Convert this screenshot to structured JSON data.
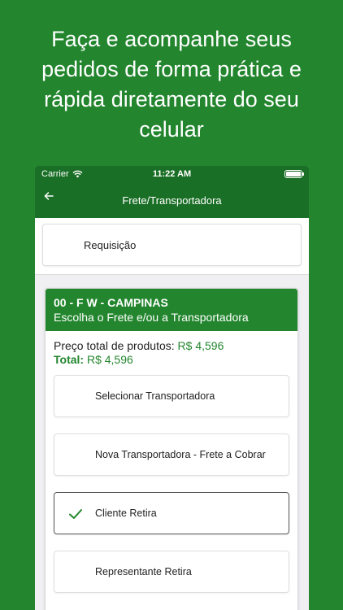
{
  "promo": {
    "headline": "Faça e acompanhe seus pedidos de forma prática e rápida diretamente do seu celular"
  },
  "status_bar": {
    "carrier": "Carrier",
    "time": "11:22 AM"
  },
  "navbar": {
    "back_icon": "back-arrow-icon",
    "title": "Frete/Transportadora"
  },
  "requisicao": {
    "label": "Requisição"
  },
  "order": {
    "code": "00 - F W - CAMPINAS",
    "subtitle": "Escolha o Frete e/ou a Transportadora",
    "products_label": "Preço total de produtos:",
    "products_value": "R$ 4,596",
    "total_label": "Total:",
    "total_value": "R$ 4,596",
    "options": [
      {
        "label": "Selecionar Transportadora",
        "selected": false
      },
      {
        "label": "Nova Transportadora - Frete a Cobrar",
        "selected": false
      },
      {
        "label": "Cliente Retira",
        "selected": true
      },
      {
        "label": "Representante Retira",
        "selected": false
      }
    ]
  },
  "colors": {
    "background": "#23862e",
    "navbar": "#1a6f26",
    "accent": "#23862e"
  }
}
